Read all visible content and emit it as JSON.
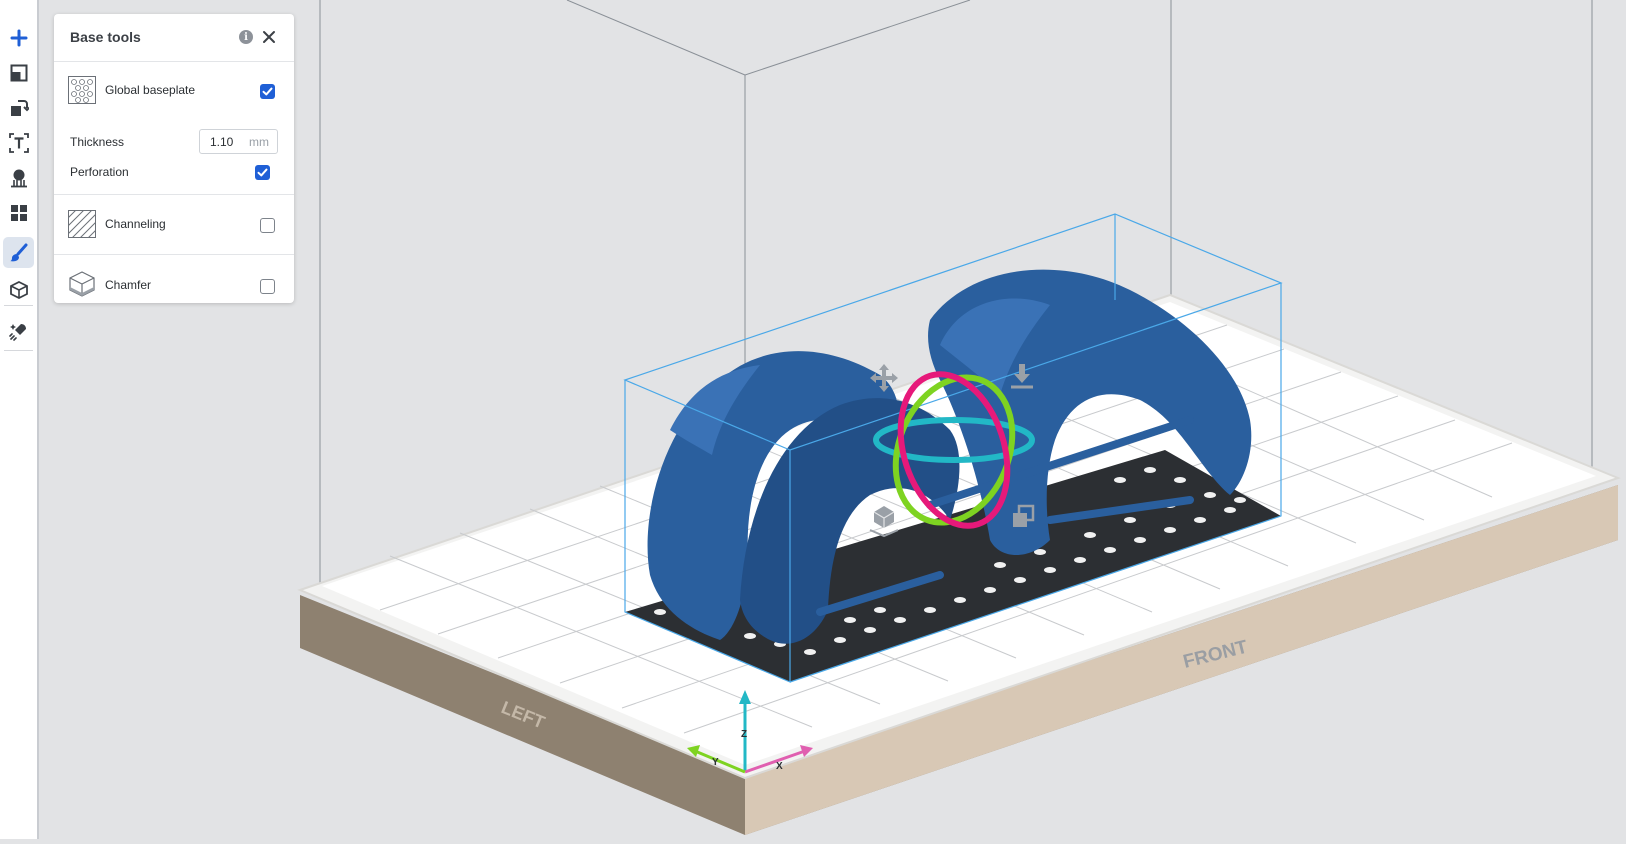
{
  "toolbar": {
    "items": [
      {
        "name": "add-icon"
      },
      {
        "name": "layout-icon"
      },
      {
        "name": "transform-icon"
      },
      {
        "name": "text-icon"
      },
      {
        "name": "supports-icon"
      },
      {
        "name": "arrange-icon"
      },
      {
        "name": "base-tools-icon",
        "active": true
      },
      {
        "name": "hollow-icon"
      },
      {
        "name": "prepare-icon"
      }
    ]
  },
  "panel": {
    "title": "Base tools",
    "global_baseplate": {
      "label": "Global baseplate",
      "checked": true
    },
    "thickness": {
      "label": "Thickness",
      "value": "1.10",
      "unit": "mm"
    },
    "perforation": {
      "label": "Perforation",
      "checked": true
    },
    "channeling": {
      "label": "Channeling",
      "checked": false
    },
    "chamfer": {
      "label": "Chamfer",
      "checked": false
    }
  },
  "scene": {
    "front_label": "FRONT",
    "left_label": "LEFT",
    "axes": {
      "x": "X",
      "y": "Y",
      "z": "Z"
    },
    "colors": {
      "model": "#2a5f9e",
      "bounding_box": "#4aa8e8",
      "plate_top": "#ffffff",
      "plate_side": "#9a8a7a",
      "rotate_x": "#e6197a",
      "rotate_y": "#7ed321",
      "rotate_z": "#22b8c6",
      "accent": "#1f5fd6"
    }
  }
}
